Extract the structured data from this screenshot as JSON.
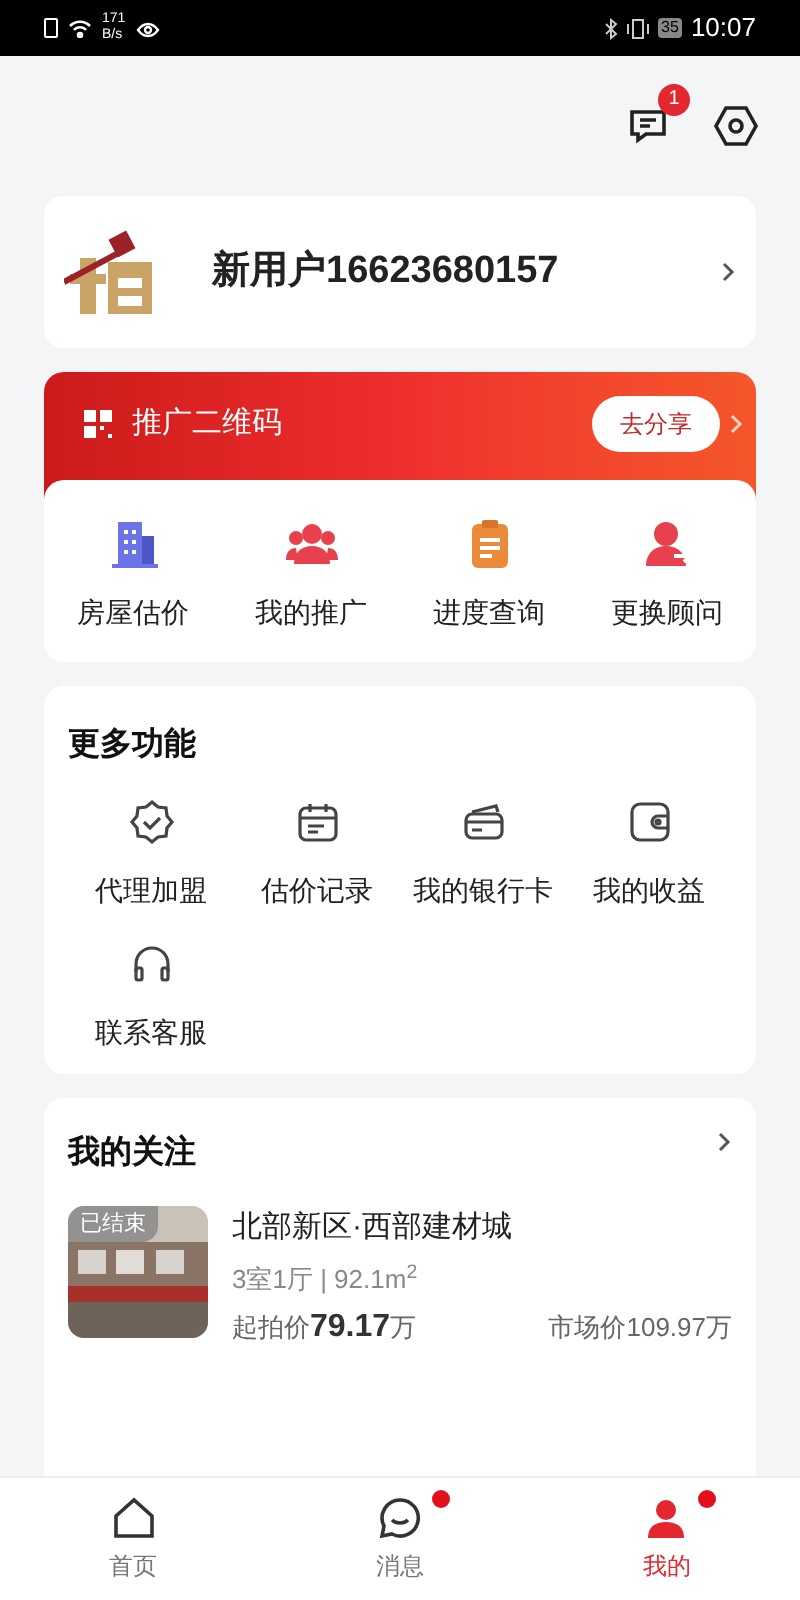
{
  "status_bar": {
    "speed": "171",
    "speed_unit": "B/s",
    "battery": "35",
    "time": "10:07"
  },
  "header": {
    "message_badge": "1"
  },
  "user": {
    "name": "新用户16623680157"
  },
  "promo": {
    "title": "推广二维码",
    "share_button": "去分享"
  },
  "quick_actions": [
    {
      "label": "房屋估价",
      "kind": "building"
    },
    {
      "label": "我的推广",
      "kind": "people"
    },
    {
      "label": "进度查询",
      "kind": "clipboard"
    },
    {
      "label": "更换顾问",
      "kind": "swap-user"
    }
  ],
  "more": {
    "title": "更多功能",
    "items": [
      {
        "label": "代理加盟",
        "kind": "badge"
      },
      {
        "label": "估价记录",
        "kind": "calendar"
      },
      {
        "label": "我的银行卡",
        "kind": "card"
      },
      {
        "label": "我的收益",
        "kind": "wallet"
      },
      {
        "label": "联系客服",
        "kind": "headset"
      }
    ]
  },
  "follow": {
    "title": "我的关注",
    "items": [
      {
        "status": "已结束",
        "title": "北部新区·西部建材城",
        "specs": "3室1厅 | 92.1m$^{2}$",
        "start_price": "起拍价**79.17**万",
        "market_price": "市场价109.97万"
      }
    ]
  },
  "nav": [
    {
      "label": "首页",
      "kind": "home",
      "selected": false,
      "dot": false
    },
    {
      "label": "消息",
      "kind": "chat",
      "selected": false,
      "dot": true
    },
    {
      "label": "我的",
      "kind": "user",
      "selected": true,
      "dot": true
    }
  ]
}
